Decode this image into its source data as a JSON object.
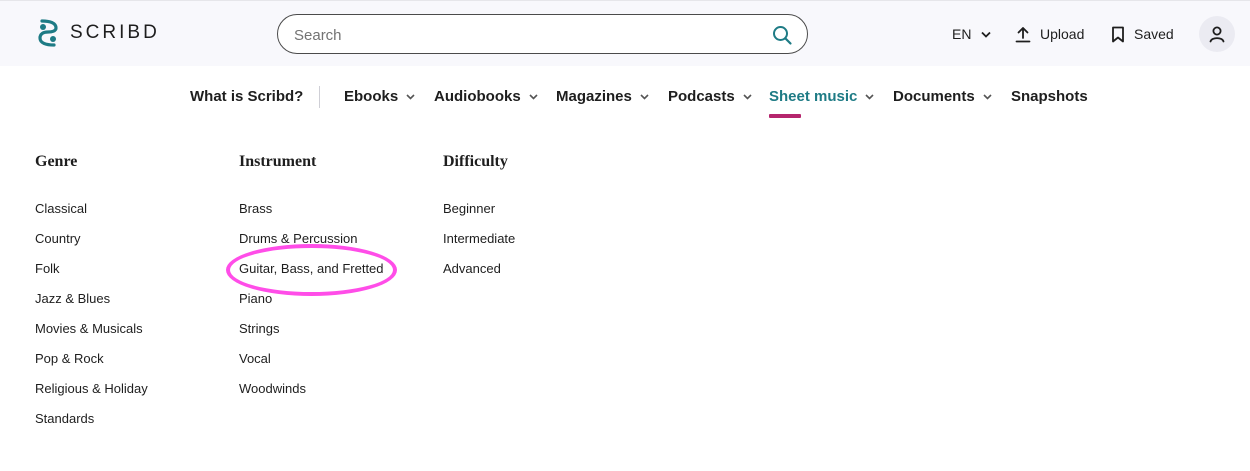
{
  "header": {
    "logo_text": "SCRIBD",
    "search_placeholder": "Search",
    "language": "EN",
    "upload_label": "Upload",
    "saved_label": "Saved"
  },
  "categories": {
    "what_is": "What is Scribd?",
    "items": [
      "Ebooks",
      "Audiobooks",
      "Magazines",
      "Podcasts",
      "Sheet music",
      "Documents",
      "Snapshots"
    ],
    "active": "Sheet music"
  },
  "menu": {
    "genre": {
      "heading": "Genre",
      "links": [
        "Classical",
        "Country",
        "Folk",
        "Jazz & Blues",
        "Movies & Musicals",
        "Pop & Rock",
        "Religious & Holiday",
        "Standards"
      ]
    },
    "instrument": {
      "heading": "Instrument",
      "links": [
        "Brass",
        "Drums & Percussion",
        "Guitar, Bass, and Fretted",
        "Piano",
        "Strings",
        "Vocal",
        "Woodwinds"
      ]
    },
    "difficulty": {
      "heading": "Difficulty",
      "links": [
        "Beginner",
        "Intermediate",
        "Advanced"
      ]
    }
  },
  "colors": {
    "brand_teal": "#1e7b85",
    "active_underline": "#b5256d",
    "annotation_ring": "#ff4de8"
  },
  "icons": {
    "search": "search-icon",
    "language_chevron": "chevron-down-icon",
    "upload": "upload-icon",
    "saved": "bookmark-icon",
    "account": "user-icon"
  }
}
